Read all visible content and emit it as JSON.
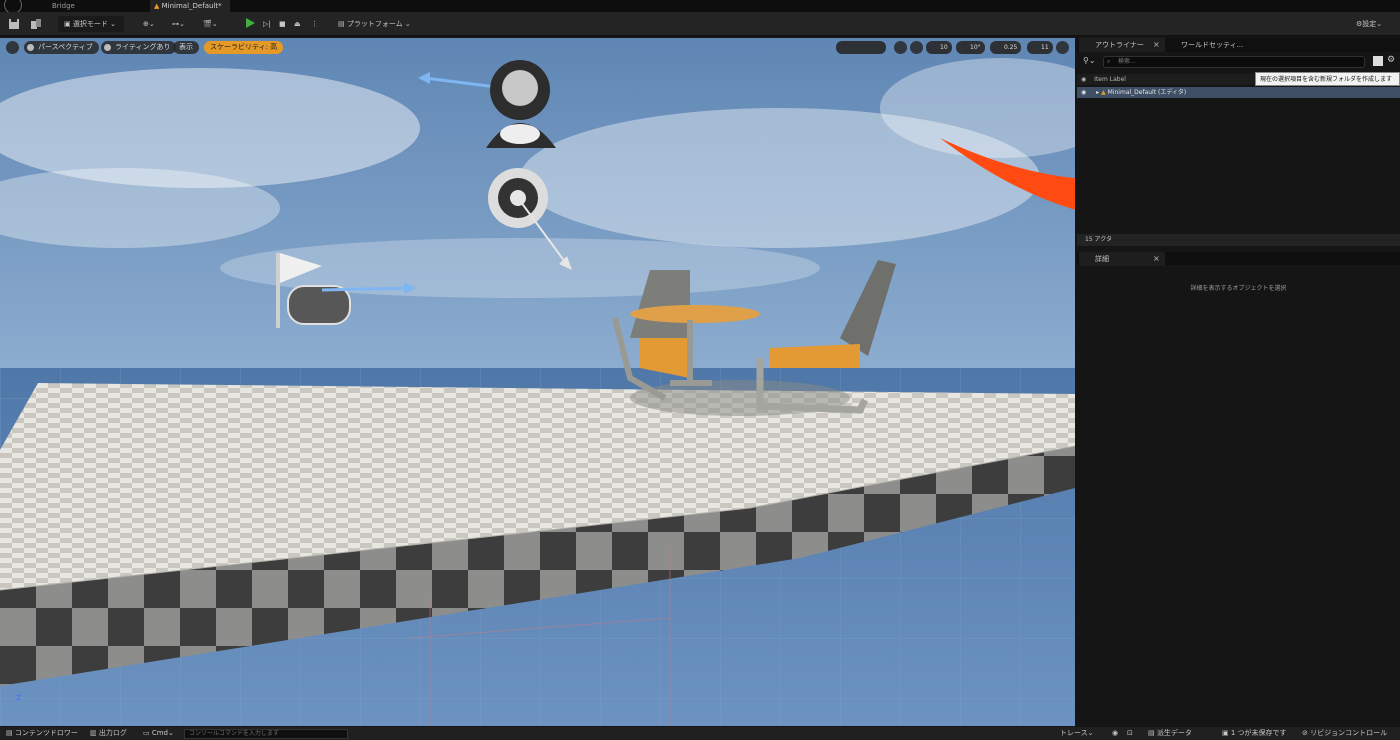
{
  "titlebar": {
    "tabs": [
      "Bridge",
      "Minimal_Default*"
    ]
  },
  "toolbar": {
    "mode_label": "選択モード",
    "platform_label": "プラットフォーム",
    "settings_label": "設定"
  },
  "viewport": {
    "perspective_label": "パースペクティブ",
    "lighting_label": "ライティングあり",
    "show_label": "表示",
    "scalability_label": "スケーラビリティ: 高",
    "grid_snap_value": "10",
    "rotation_snap_value": "10°",
    "scale_snap_value": "0.25",
    "camera_speed_value": "11",
    "axis_label": "Z"
  },
  "outliner": {
    "tab_label": "アウトライナー",
    "world_settings_tab_label": "ワールドセッティ...",
    "search_placeholder": "検索...",
    "column_label": "Item Label",
    "tree_item_label": "Minimal_Default (エディタ)",
    "tooltip_text": "現在の選択項目を含む新規フォルダを作成します",
    "actor_count": "15 アクタ"
  },
  "details": {
    "tab_label": "詳細",
    "empty_message": "詳細を表示するオブジェクトを選択"
  },
  "statusbar": {
    "content_drawer": "コンテンツドロワー",
    "output_log": "出力ログ",
    "cmd_label": "Cmd",
    "console_placeholder": "コンソールコマンドを入力します",
    "trace_label": "トレース",
    "derived_data_label": "派生データ",
    "unsaved_label": "1 つが未保存です",
    "revision_control_label": "リビジョンコントロール"
  },
  "colors": {
    "accent_orange": "#e59a28",
    "arrow_red": "#ff4a12",
    "selection_blue": "#3e4f66",
    "play_green": "#3fae3f"
  }
}
